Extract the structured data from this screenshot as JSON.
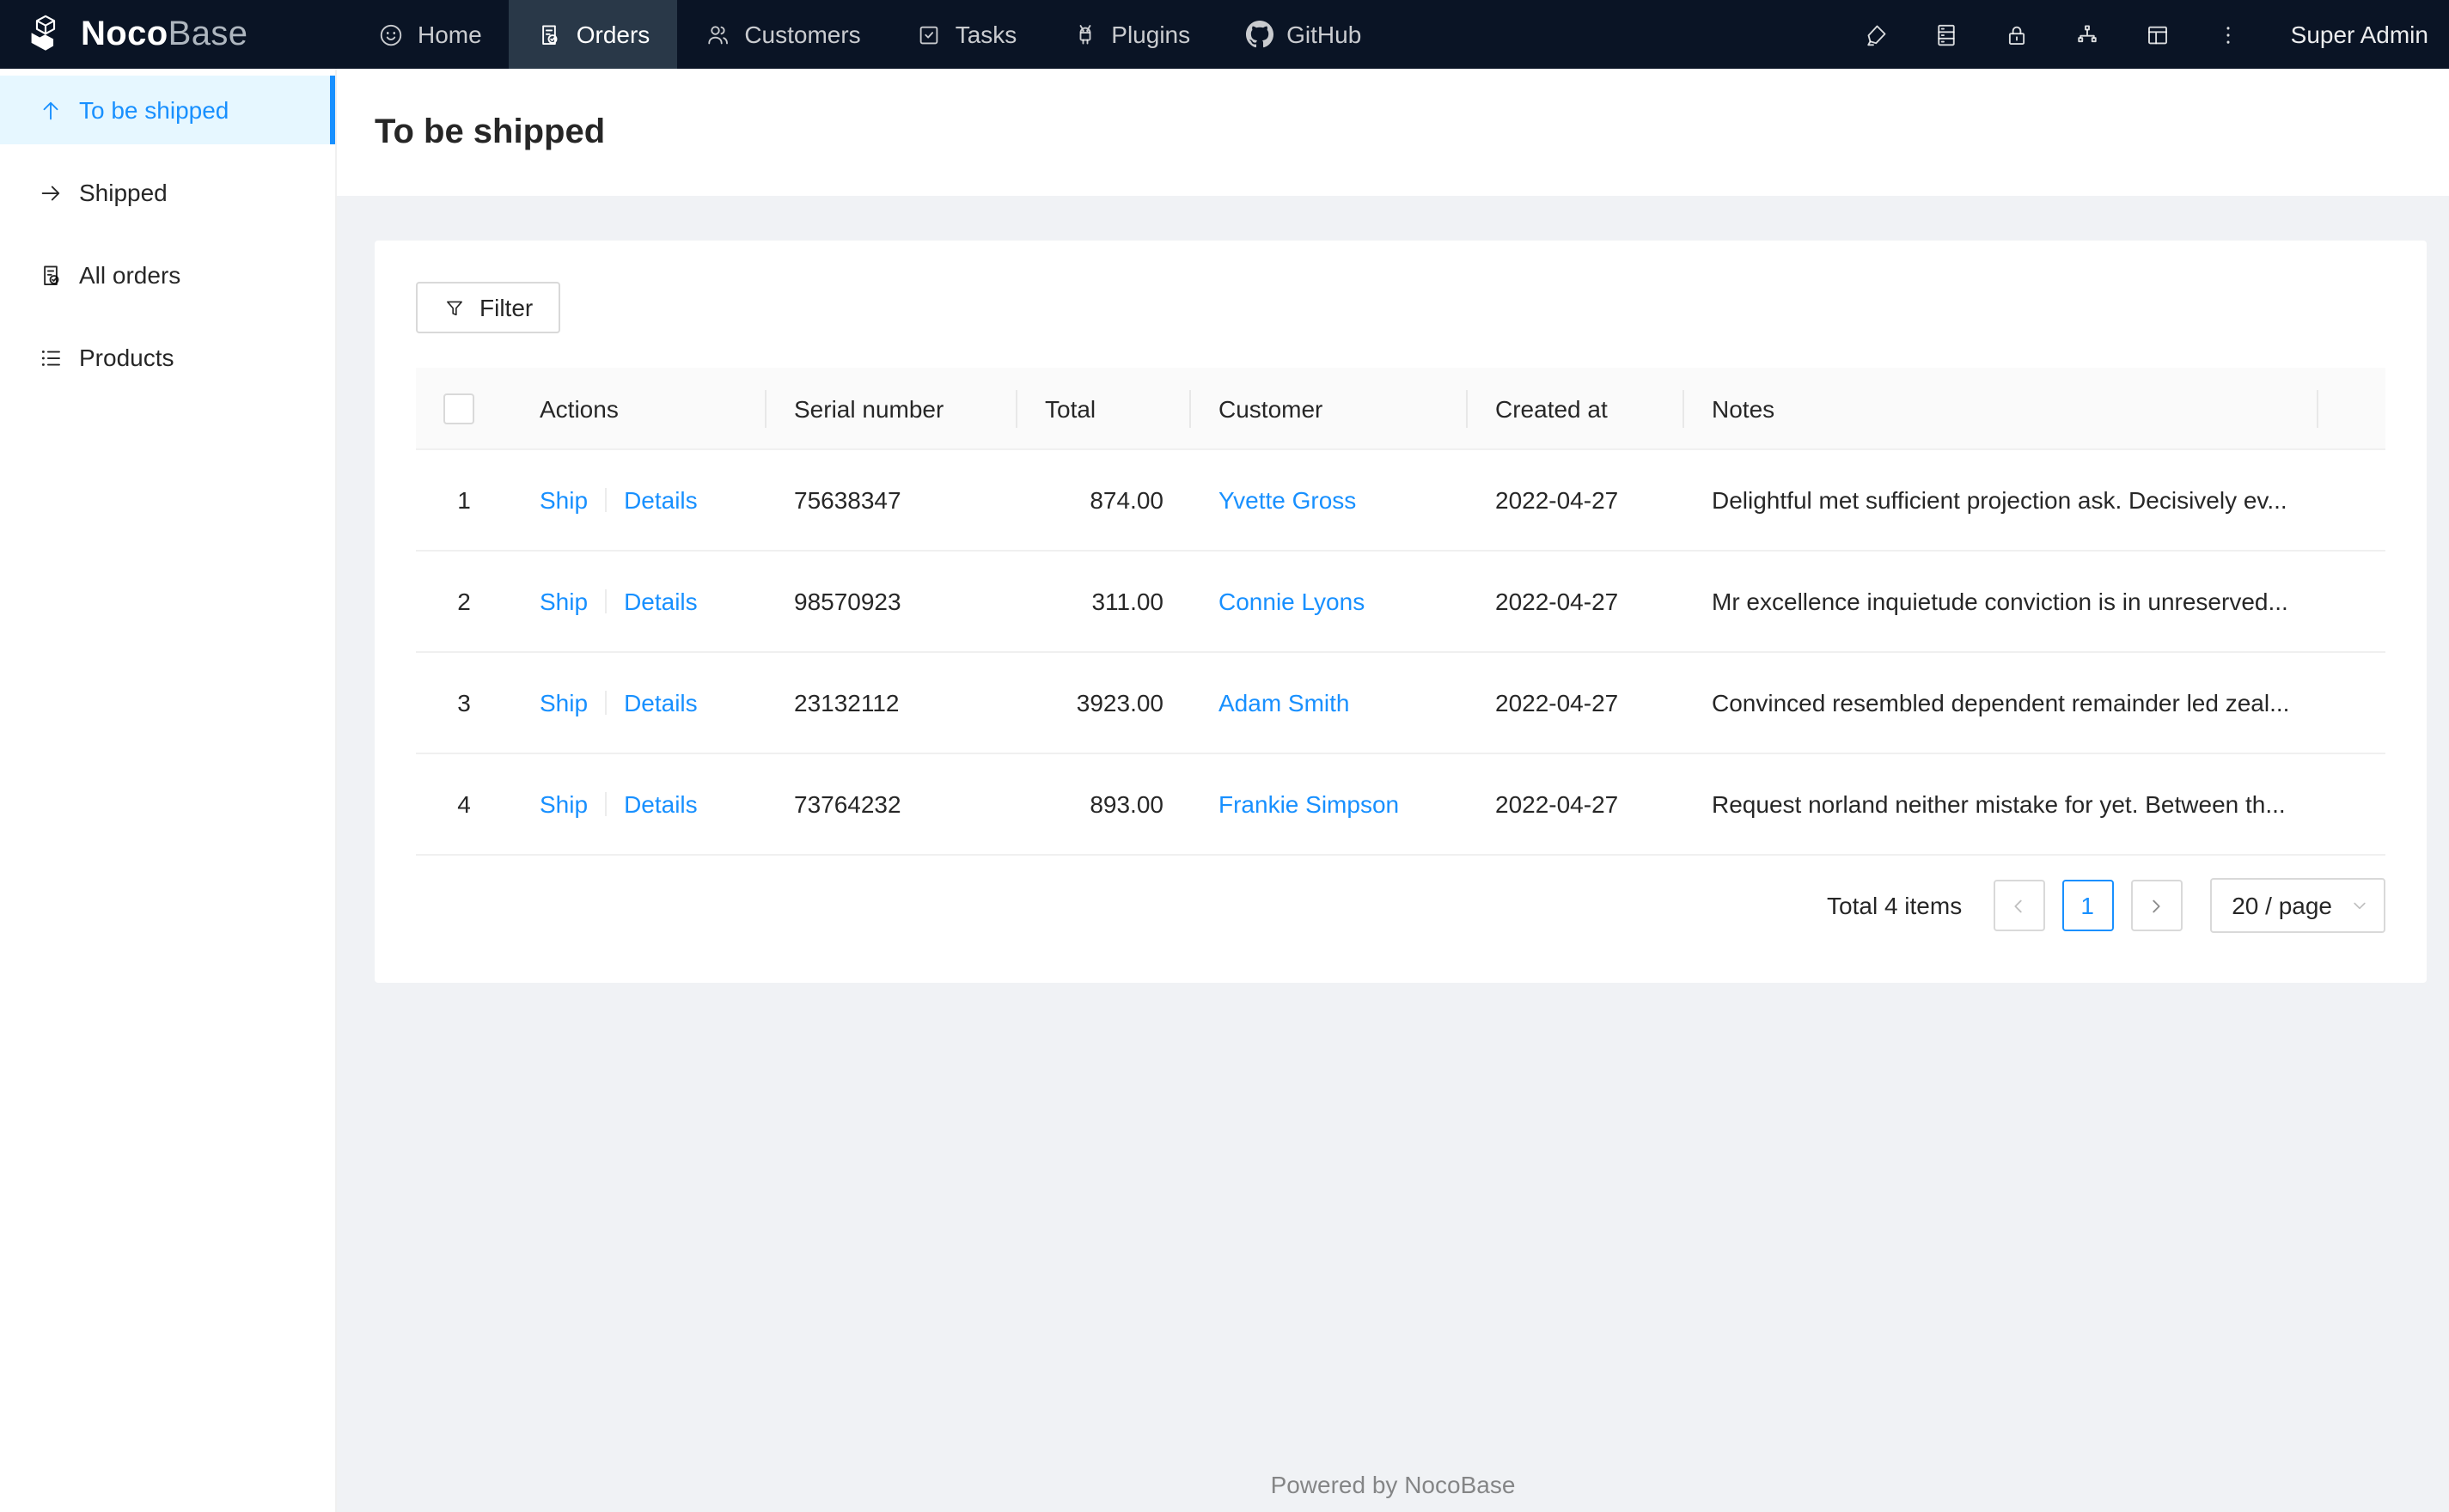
{
  "navbar": {
    "logo": {
      "text_bold": "Noco",
      "text_light": "Base"
    },
    "items": [
      {
        "label": "Home",
        "icon": "smile-icon",
        "active": false
      },
      {
        "label": "Orders",
        "icon": "audit-icon",
        "active": true
      },
      {
        "label": "Customers",
        "icon": "team-icon",
        "active": false
      },
      {
        "label": "Tasks",
        "icon": "carry-out-icon",
        "active": false
      },
      {
        "label": "Plugins",
        "icon": "android-icon",
        "active": false
      },
      {
        "label": "GitHub",
        "icon": "github-icon",
        "active": false
      }
    ],
    "right_icons": [
      "highlight-icon",
      "database-icon",
      "lock-icon",
      "apartment-icon",
      "layout-icon",
      "more-icon"
    ],
    "user": "Super Admin"
  },
  "sidebar": {
    "items": [
      {
        "label": "To be shipped",
        "icon": "arrow-up-icon",
        "active": true
      },
      {
        "label": "Shipped",
        "icon": "arrow-right-icon",
        "active": false
      },
      {
        "label": "All orders",
        "icon": "audit-icon",
        "active": false
      },
      {
        "label": "Products",
        "icon": "unordered-list-icon",
        "active": false
      }
    ]
  },
  "page": {
    "title": "To be shipped"
  },
  "toolbar": {
    "filter_label": "Filter"
  },
  "table": {
    "columns": [
      "Actions",
      "Serial number",
      "Total",
      "Customer",
      "Created at",
      "Notes"
    ],
    "rows": [
      {
        "index": "1",
        "action_ship": "Ship",
        "action_details": "Details",
        "serial": "75638347",
        "total": "874.00",
        "customer": "Yvette Gross",
        "created_at": "2022-04-27",
        "notes": "Delightful met sufficient projection ask. Decisively ev..."
      },
      {
        "index": "2",
        "action_ship": "Ship",
        "action_details": "Details",
        "serial": "98570923",
        "total": "311.00",
        "customer": "Connie Lyons",
        "created_at": "2022-04-27",
        "notes": "Mr excellence inquietude conviction is in unreserved..."
      },
      {
        "index": "3",
        "action_ship": "Ship",
        "action_details": "Details",
        "serial": "23132112",
        "total": "3923.00",
        "customer": "Adam Smith",
        "created_at": "2022-04-27",
        "notes": "Convinced resembled dependent remainder led zeal..."
      },
      {
        "index": "4",
        "action_ship": "Ship",
        "action_details": "Details",
        "serial": "73764232",
        "total": "893.00",
        "customer": "Frankie Simpson",
        "created_at": "2022-04-27",
        "notes": "Request norland neither mistake for yet. Between th..."
      }
    ]
  },
  "pagination": {
    "total_text": "Total 4 items",
    "current_page": "1",
    "page_size": "20 / page"
  },
  "footer": {
    "text": "Powered by NocoBase"
  },
  "colors": {
    "accent": "#1890ff",
    "navbar_bg": "#0a1425",
    "navbar_active_bg": "#293848",
    "sidebar_active_bg": "#e6f7ff",
    "page_bg": "#f0f2f5",
    "border": "#f0f0f0",
    "table_header_bg": "#fafafa"
  }
}
